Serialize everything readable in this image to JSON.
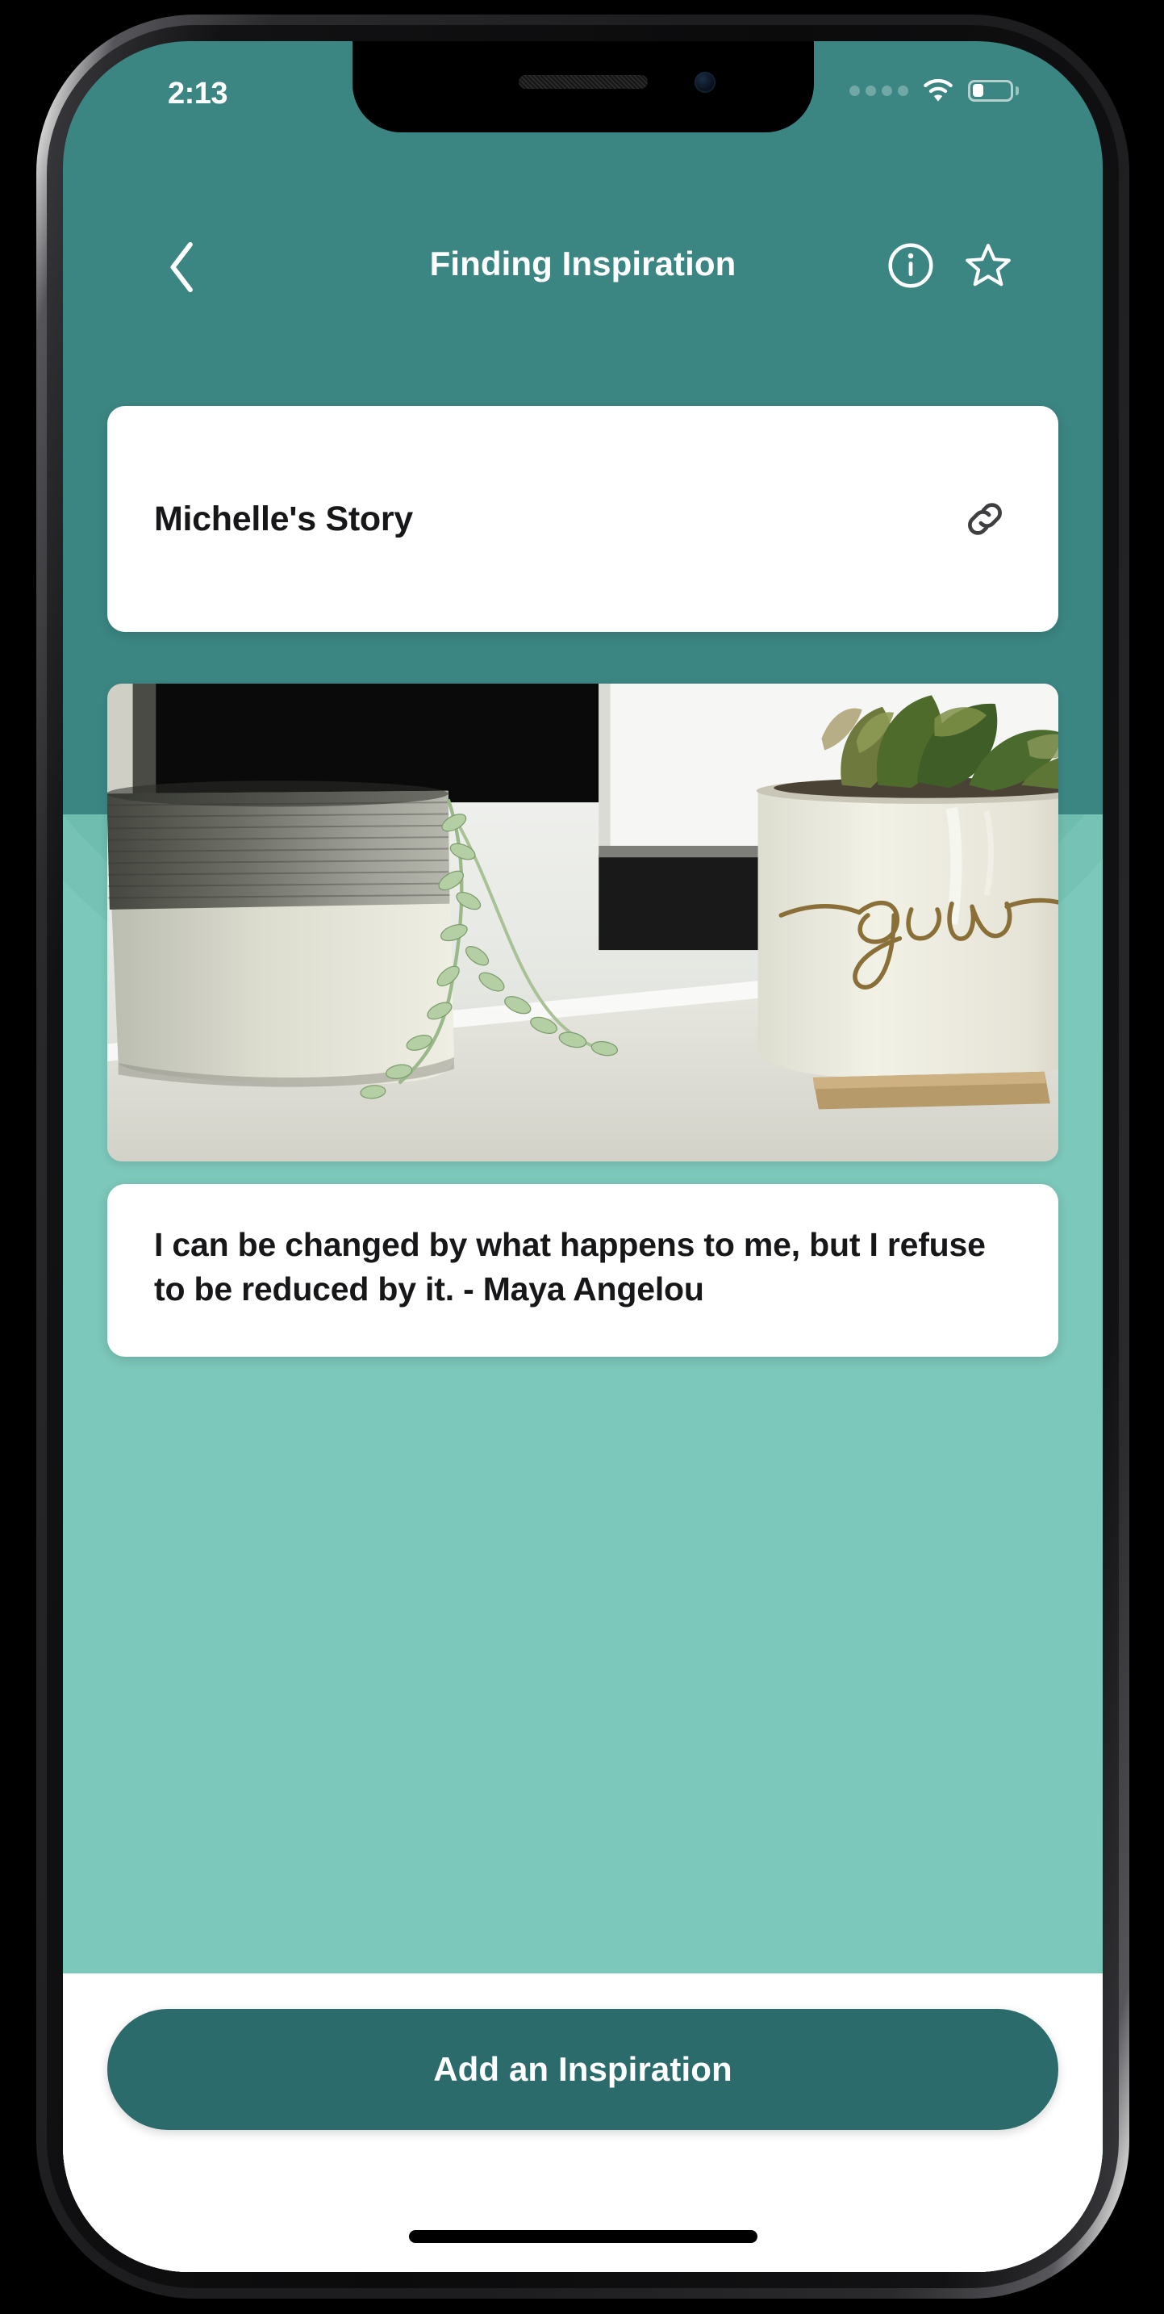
{
  "status_bar": {
    "time": "2:13",
    "signal_dots": 4,
    "wifi_icon": "wifi-icon",
    "battery_icon": "battery-icon",
    "battery_level_percent": 31
  },
  "nav_bar": {
    "back_icon": "chevron-left-icon",
    "title": "Finding Inspiration",
    "info_icon": "info-circle-icon",
    "favorite_icon": "star-outline-icon"
  },
  "story_card": {
    "title": "Michelle's Story",
    "link_icon": "link-chain-icon"
  },
  "photo_card": {
    "alt": "Two potted plants on a sunlit windowsill; right pot has handwritten script",
    "pot_script_text": "grow"
  },
  "quote_card": {
    "text": "I can be changed by what happens to me, but I refuse to be reduced by it. - Maya Angelou"
  },
  "bottom": {
    "add_button_label": "Add an Inspiration",
    "home_indicator": "home-indicator"
  },
  "colors": {
    "header_teal": "#3b8683",
    "wave_mint": "#79c6b7",
    "wave_mint_light": "#a6dbd0",
    "button_dark_teal": "#2b6b6b",
    "card_white": "#ffffff",
    "text_dark": "#17171a"
  }
}
